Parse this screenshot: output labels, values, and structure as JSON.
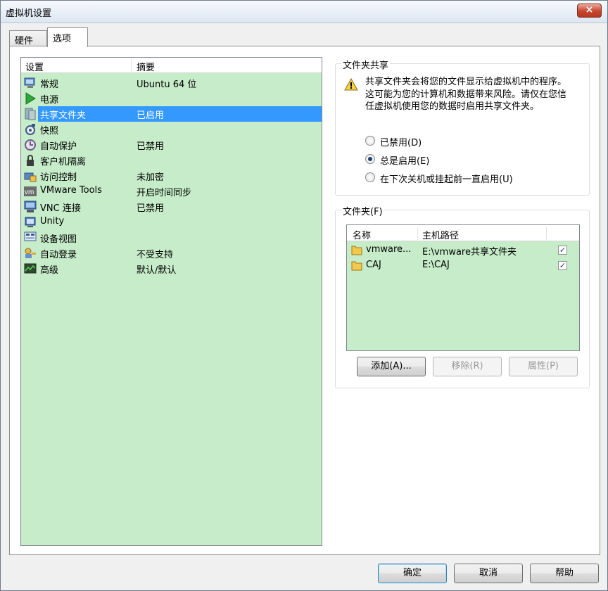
{
  "window": {
    "title": "虚拟机设置",
    "close_label": "×"
  },
  "tabs": [
    {
      "label": "硬件"
    },
    {
      "label": "选项"
    }
  ],
  "settings": {
    "header": {
      "col1": "设置",
      "col2": "摘要"
    },
    "items": [
      {
        "name": "常规",
        "summary": "Ubuntu 64 位",
        "icon": "general-icon"
      },
      {
        "name": "电源",
        "summary": "",
        "icon": "power-icon"
      },
      {
        "name": "共享文件夹",
        "summary": "已启用",
        "icon": "shared-folder-icon",
        "selected": true
      },
      {
        "name": "快照",
        "summary": "",
        "icon": "snapshot-icon"
      },
      {
        "name": "自动保护",
        "summary": "已禁用",
        "icon": "autoprotect-icon"
      },
      {
        "name": "客户机隔离",
        "summary": "",
        "icon": "isolation-icon"
      },
      {
        "name": "访问控制",
        "summary": "未加密",
        "icon": "access-control-icon"
      },
      {
        "name": "VMware Tools",
        "summary": "开启时间同步",
        "icon": "vmware-tools-icon"
      },
      {
        "name": "VNC 连接",
        "summary": "已禁用",
        "icon": "vnc-icon"
      },
      {
        "name": "Unity",
        "summary": "",
        "icon": "unity-icon"
      },
      {
        "name": "设备视图",
        "summary": "",
        "icon": "device-view-icon"
      },
      {
        "name": "自动登录",
        "summary": "不受支持",
        "icon": "autologin-icon"
      },
      {
        "name": "高级",
        "summary": "默认/默认",
        "icon": "advanced-icon"
      }
    ]
  },
  "folder_sharing": {
    "title": "文件夹共享",
    "warning": "共享文件夹会将您的文件显示给虚拟机中的程序。这可能为您的计算机和数据带来风险。请仅在您信任虚拟机使用您的数据时启用共享文件夹。",
    "options": [
      {
        "label": "已禁用(D)",
        "checked": false
      },
      {
        "label": "总是启用(E)",
        "checked": true
      },
      {
        "label": "在下次关机或挂起前一直启用(U)",
        "checked": false
      }
    ]
  },
  "folders": {
    "title": "文件夹(F)",
    "columns": {
      "name": "名称",
      "host_path": "主机路径"
    },
    "rows": [
      {
        "name": "vmware...",
        "host_path": "E:\\vmware共享文件夹",
        "checked": true
      },
      {
        "name": "CAJ",
        "host_path": "E:\\CAJ",
        "checked": true
      }
    ],
    "add_label": "添加(A)...",
    "remove_label": "移除(R)",
    "properties_label": "属性(P)"
  },
  "footer": {
    "ok_label": "确定",
    "cancel_label": "取消",
    "help_label": "帮助"
  },
  "colors": {
    "list_background": "#c6ecc9",
    "selection": "#3399ff"
  },
  "check_glyph": "✓"
}
